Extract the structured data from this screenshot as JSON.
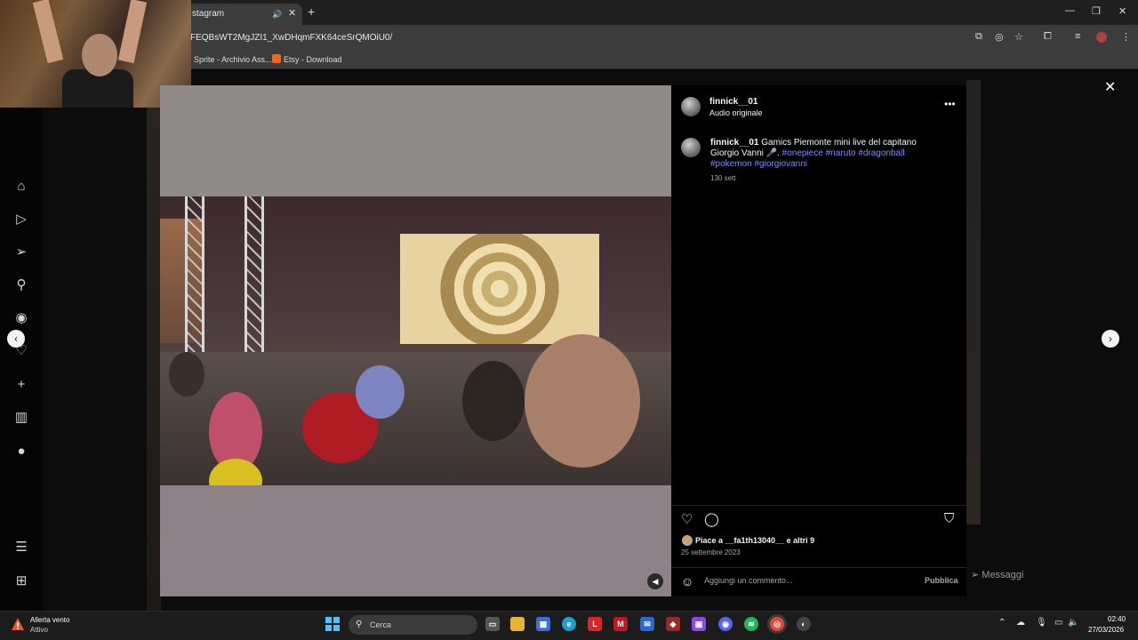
{
  "browser": {
    "tab_title": "stagram",
    "url": "FEQBsWT2MgJZI1_XwDHqmFXK64ceSrQMOiU0/",
    "bookmarks": [
      "Sprite - Archivio Ass...",
      "Etsy - Download"
    ]
  },
  "post": {
    "username": "finnick__01",
    "audio": "Audio originale",
    "caption_user": "finnick__01",
    "caption_text": "Gamics Piemonte mini live del capitano Giorgio Vanni 🎤.",
    "hashtags": [
      "#onepiece",
      "#naruto",
      "#dragonball",
      "#pokemon",
      "#giorgiovanni"
    ],
    "time_ago": "130 sett",
    "likes_text": "Piace a __fa1th13040__ e altri 9",
    "date": "25 settembre 2023",
    "comment_placeholder": "Aggiungi un commento...",
    "publish_label": "Pubblica"
  },
  "messages_label": "Messaggi",
  "taskbar": {
    "weather_title": "Allerta vento",
    "weather_sub": "Attivo",
    "search_label": "Cerca",
    "time": "02:40",
    "date": "27/03/2026"
  },
  "colors": {
    "hashtag": "#7e8ff0",
    "panel_bg": "#000000",
    "chrome_bg": "#3c3c3c"
  }
}
